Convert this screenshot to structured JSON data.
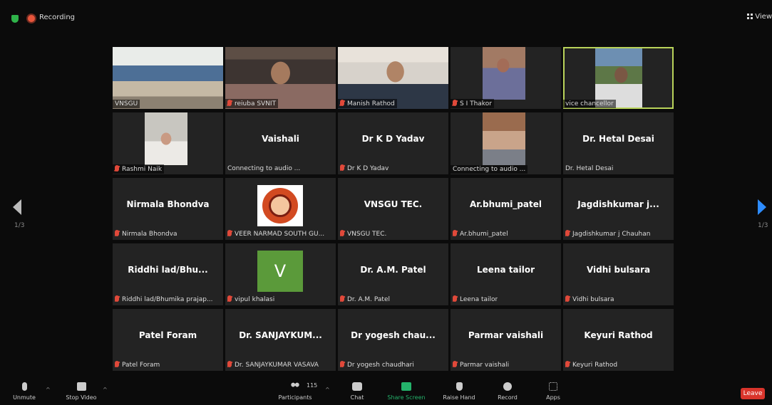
{
  "topbar": {
    "recording_label": "Recording",
    "view_label": "View"
  },
  "nav": {
    "left_page": "1/3",
    "right_page": "1/3"
  },
  "tiles": [
    {
      "name": "",
      "label": "VNSGU",
      "video": "room",
      "muted": false
    },
    {
      "name": "",
      "label": "reiuba SVNIT",
      "video": "man",
      "muted": true
    },
    {
      "name": "",
      "label": "Manish Rathod",
      "video": "man2",
      "muted": true
    },
    {
      "name": "",
      "label": "S I Thakor",
      "video": "man3",
      "muted": true
    },
    {
      "name": "",
      "label": "vice chancellor",
      "video": "outdoor",
      "muted": false
    },
    {
      "name": "",
      "label": "Rashmi Naik",
      "video": "woman",
      "muted": true
    },
    {
      "name": "Vaishali",
      "label": "Connecting to audio ...",
      "video": "",
      "muted": false
    },
    {
      "name": "Dr K D Yadav",
      "label": "Dr K D Yadav",
      "video": "",
      "muted": true
    },
    {
      "name": "",
      "label": "Connecting to audio ...",
      "video": "group",
      "muted": false
    },
    {
      "name": "Dr. Hetal Desai",
      "label": "Dr. Hetal Desai",
      "video": "",
      "muted": false
    },
    {
      "name": "Nirmala Bhondva",
      "label": "Nirmala Bhondva",
      "video": "",
      "muted": true
    },
    {
      "name": "",
      "label": "VEER NARMAD SOUTH GU...",
      "video": "logo",
      "muted": true
    },
    {
      "name": "VNSGU TEC.",
      "label": "VNSGU TEC.",
      "video": "",
      "muted": true
    },
    {
      "name": "Ar.bhumi_patel",
      "label": "Ar.bhumi_patel",
      "video": "",
      "muted": true
    },
    {
      "name": "Jagdishkumar j...",
      "label": "Jagdishkumar j Chauhan",
      "video": "",
      "muted": true
    },
    {
      "name": "Riddhi lad/Bhu...",
      "label": "Riddhi lad/Bhumika prajap...",
      "video": "",
      "muted": true
    },
    {
      "name": "",
      "label": "vipul khalasi",
      "video": "avatar",
      "avatar_letter": "V",
      "muted": true
    },
    {
      "name": "Dr. A.M. Patel",
      "label": "Dr. A.M. Patel",
      "video": "",
      "muted": true
    },
    {
      "name": "Leena tailor",
      "label": "Leena tailor",
      "video": "",
      "muted": true
    },
    {
      "name": "Vidhi bulsara",
      "label": "Vidhi bulsara",
      "video": "",
      "muted": true
    },
    {
      "name": "Patel Foram",
      "label": "Patel Foram",
      "video": "",
      "muted": true
    },
    {
      "name": "Dr. SANJAYKUM...",
      "label": "Dr. SANJAYKUMAR VASAVA",
      "video": "",
      "muted": true
    },
    {
      "name": "Dr yogesh chau...",
      "label": "Dr yogesh chaudhari",
      "video": "",
      "muted": true
    },
    {
      "name": "Parmar vaishali",
      "label": "Parmar vaishali",
      "video": "",
      "muted": true
    },
    {
      "name": "Keyuri Rathod",
      "label": "Keyuri Rathod",
      "video": "",
      "muted": true
    }
  ],
  "toolbar": {
    "unmute": "Unmute",
    "stop_video": "Stop Video",
    "participants": "Participants",
    "participants_count": "115",
    "chat": "Chat",
    "share_screen": "Share Screen",
    "raise_hand": "Raise Hand",
    "record": "Record",
    "apps": "Apps",
    "leave": "Leave"
  }
}
